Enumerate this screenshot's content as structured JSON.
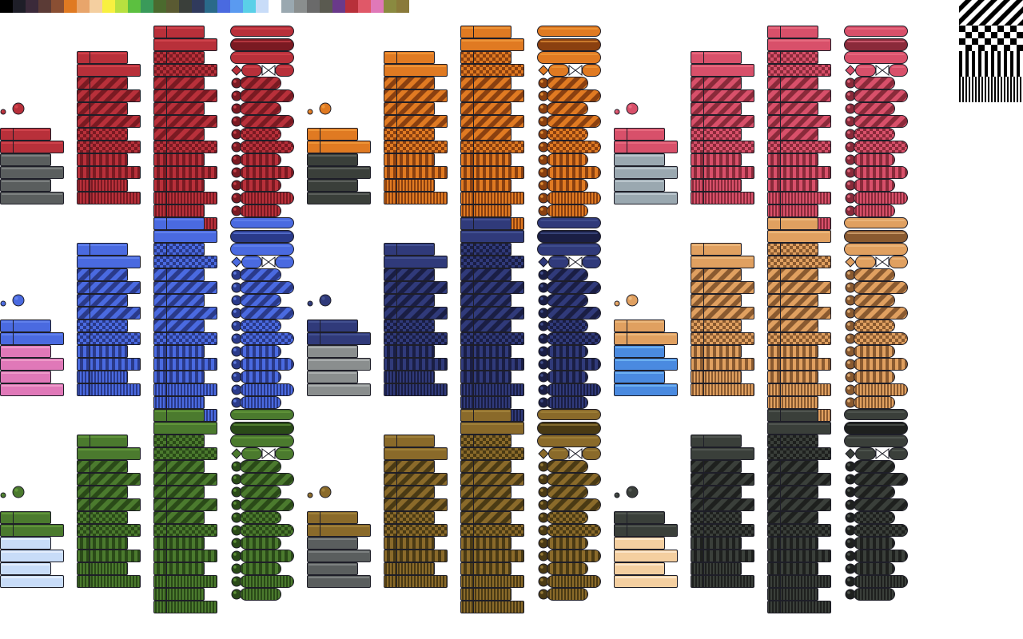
{
  "palette": [
    "#000000",
    "#1e1e28",
    "#3b2a3a",
    "#5b3b36",
    "#8a4f33",
    "#e07a22",
    "#e8a56b",
    "#f4cfa0",
    "#f8f040",
    "#b8e040",
    "#5cc040",
    "#3a9a5a",
    "#4b6a2e",
    "#5a5a32",
    "#3a3f3a",
    "#303a5c",
    "#2a6a8a",
    "#4a6ae0",
    "#5a9af0",
    "#5ad0e8",
    "#c8dcf8",
    "#ffffff",
    "#9aa8b0",
    "#8a8e8e",
    "#6a6a6a",
    "#5a5a50",
    "#6a3a8a",
    "#b8303a",
    "#e05868",
    "#e078b8",
    "#8a8a40",
    "#8a7a3a"
  ],
  "color_sets": [
    {
      "name": "red",
      "main": "#b8303a",
      "light": "#d84a52",
      "dark": "#7a1a22",
      "alt": "#5a5e5e",
      "altlight": "#8a8e8e",
      "knob": "#c03038"
    },
    {
      "name": "orange",
      "main": "#e07a22",
      "light": "#f4a040",
      "dark": "#8a4010",
      "alt": "#3a3f3a",
      "altlight": "#6a6e6a",
      "knob": "#f4a020"
    },
    {
      "name": "pink",
      "main": "#d8506a",
      "light": "#ee7488",
      "dark": "#8a2a3a",
      "alt": "#9aa8b0",
      "altlight": "#c8d2d8",
      "knob": "#e06080"
    },
    {
      "name": "blue",
      "main": "#4a6ae0",
      "light": "#6a8af0",
      "dark": "#2a3a8a",
      "alt": "#e078b8",
      "altlight": "#f4a8d0",
      "knob": "#4a80f0"
    },
    {
      "name": "navy",
      "main": "#303a7a",
      "light": "#4a5a9a",
      "dark": "#1a1e44",
      "alt": "#8a8e8e",
      "altlight": "#b8bcbc",
      "knob": "#3a4a9a"
    },
    {
      "name": "tan",
      "main": "#e0a060",
      "light": "#f0c088",
      "dark": "#8a5a30",
      "alt": "#4a8ae0",
      "altlight": "#7ac0f8",
      "knob": "#e8a868"
    },
    {
      "name": "green",
      "main": "#4b7a2e",
      "light": "#6aa040",
      "dark": "#2a4a18",
      "alt": "#c8dcf8",
      "altlight": "#eef4ff",
      "knob": "#4a8a30"
    },
    {
      "name": "olive",
      "main": "#8a6a2a",
      "light": "#a88a40",
      "dark": "#4a3a14",
      "alt": "#5a5e5e",
      "altlight": "#8a8e8e",
      "knob": "#8a6a30"
    },
    {
      "name": "slate",
      "main": "#3a3f3a",
      "light": "#5a605a",
      "dark": "#1e201e",
      "alt": "#f4cfa0",
      "altlight": "#fff0dc",
      "knob": "#3a3a30"
    }
  ],
  "stripe_color": "#b8c4cc",
  "outline_color": "#1e1e28"
}
